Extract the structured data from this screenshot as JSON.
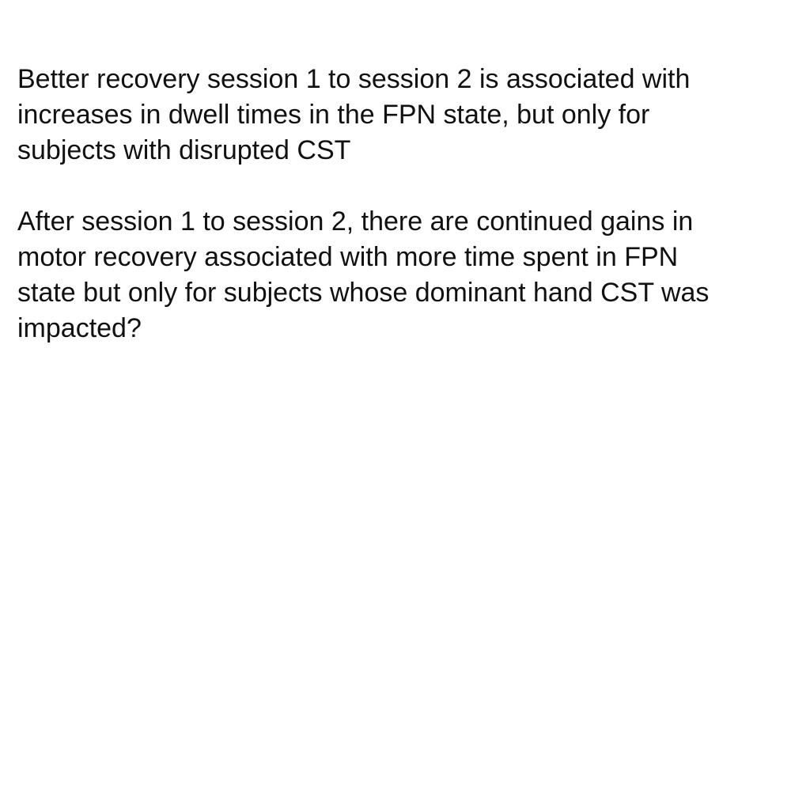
{
  "paragraphs": [
    {
      "lines": [
        "Better recovery session 1 to session 2 is associated with",
        "increases in dwell times in the FPN state, but only for",
        "subjects with disrupted CST"
      ]
    },
    {
      "lines": [
        "After session 1 to session 2, there are continued gains in",
        "motor recovery associated with more time spent in FPN",
        "state but only for subjects whose dominant hand CST was",
        "impacted?"
      ]
    }
  ]
}
